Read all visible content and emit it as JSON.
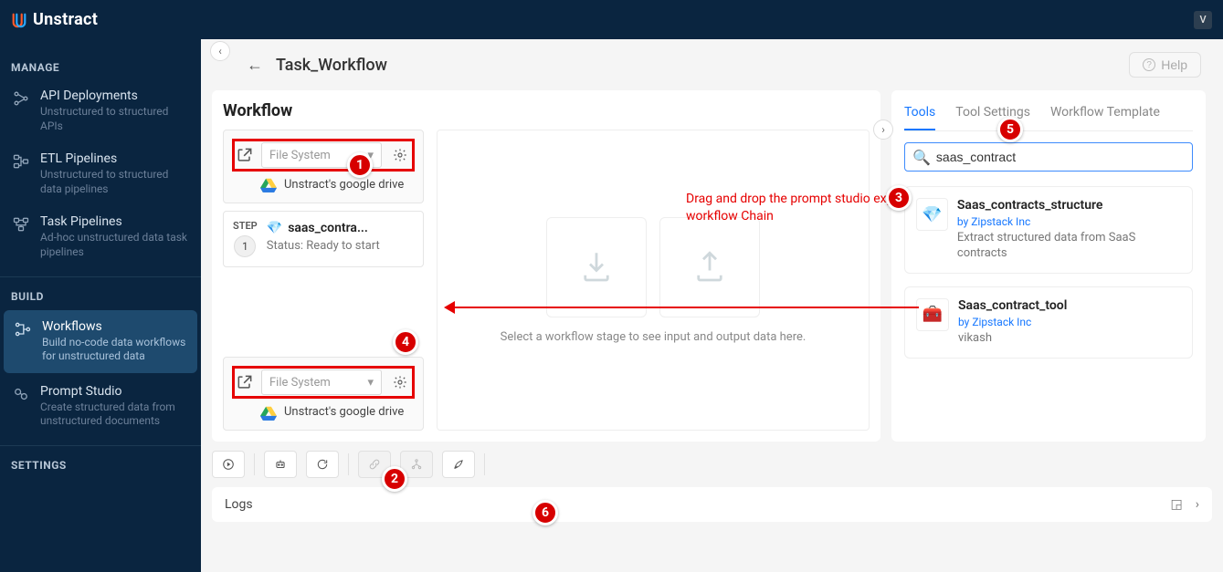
{
  "brand": {
    "name": "Unstract",
    "avatar": "V"
  },
  "sidebar": {
    "sections": {
      "manage": "MANAGE",
      "build": "BUILD",
      "settings": "SETTINGS"
    },
    "items": {
      "api": {
        "title": "API Deployments",
        "sub": "Unstructured to structured APIs"
      },
      "etl": {
        "title": "ETL Pipelines",
        "sub": "Unstructured to structured data pipelines"
      },
      "task": {
        "title": "Task Pipelines",
        "sub": "Ad-hoc unstructured data task pipelines"
      },
      "wf": {
        "title": "Workflows",
        "sub": "Build no-code data workflows for unstructured data"
      },
      "ps": {
        "title": "Prompt Studio",
        "sub": "Create structured data from unstructured documents"
      }
    }
  },
  "page": {
    "title": "Task_Workflow",
    "help": "Help"
  },
  "workflow": {
    "header": "Workflow",
    "source_select": "File System",
    "dest_select": "File System",
    "drive_label": "Unstract's google drive",
    "step_label": "STEP",
    "step_num": "1",
    "step_title": "saas_contra...",
    "step_status": "Status: Ready to start",
    "placeholder_text": "Select a workflow stage to see input and output data here.",
    "annotation": "Drag and drop the prompt studio exported tool to the workflow Chain"
  },
  "right": {
    "tabs": {
      "tools": "Tools",
      "settings": "Tool Settings",
      "template": "Workflow Template"
    },
    "search_value": "saas_contract",
    "tools": {
      "a": {
        "name": "Saas_contracts_structure",
        "by": "by Zipstack Inc",
        "desc": "Extract structured data from SaaS contracts"
      },
      "b": {
        "name": "Saas_contract_tool",
        "by": "by Zipstack Inc",
        "desc": "vikash"
      }
    }
  },
  "callouts": {
    "c1": "1",
    "c2": "2",
    "c3": "3",
    "c4": "4",
    "c5": "5",
    "c6": "6"
  },
  "logs": {
    "label": "Logs"
  }
}
